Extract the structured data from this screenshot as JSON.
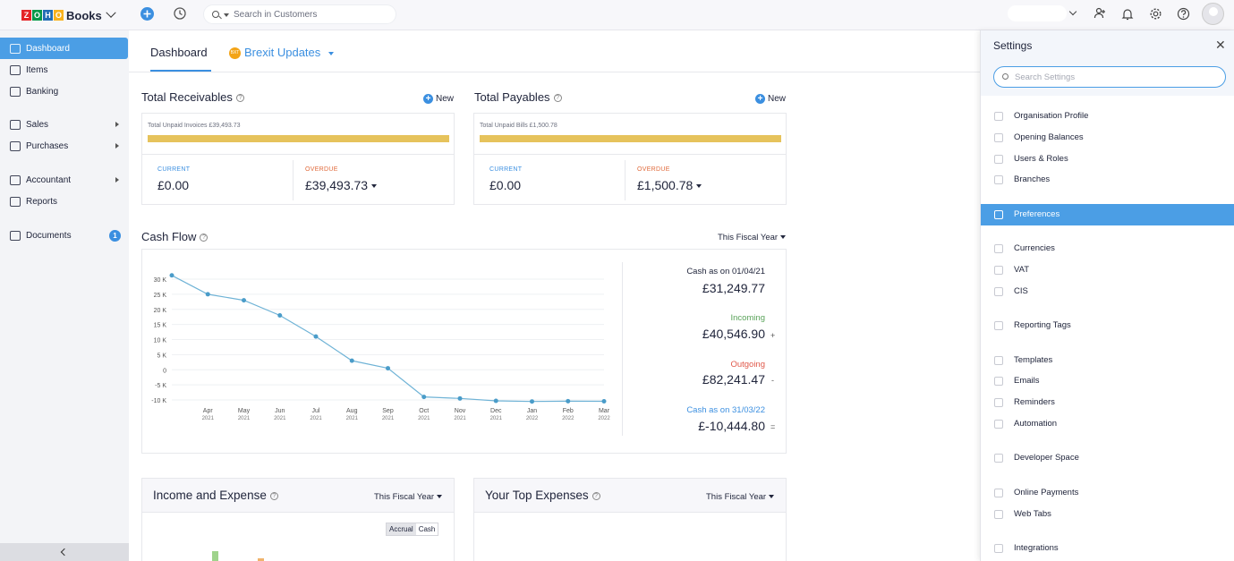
{
  "topbar": {
    "logo_letters": [
      "Z",
      "O",
      "H",
      "O"
    ],
    "logo_word": "Books",
    "search_placeholder": "Search in Customers"
  },
  "colors": {
    "accent": "#4b9ee5",
    "logo_z": "#e42527",
    "logo_o1": "#089949",
    "logo_h": "#226db4",
    "logo_o2": "#f9b21d",
    "bar": "#e6c35c",
    "current_label": "#3b8fe0",
    "overdue_label": "#e06a3b",
    "incoming": "#5aa35a",
    "outgoing": "#e0584a",
    "line": "#6fb3d6"
  },
  "sidebar": {
    "items": [
      {
        "label": "Dashboard",
        "active": true
      },
      {
        "label": "Items"
      },
      {
        "label": "Banking"
      },
      {
        "label": "Sales",
        "arrow": true
      },
      {
        "label": "Purchases",
        "arrow": true
      },
      {
        "label": "Accountant",
        "arrow": true
      },
      {
        "label": "Reports"
      },
      {
        "label": "Documents",
        "badge": "1"
      }
    ]
  },
  "tabs": {
    "dashboard": "Dashboard",
    "brexit": "Brexit Updates",
    "brexit_icon_text": "BXT"
  },
  "receivables": {
    "title": "Total Receivables",
    "new": "New",
    "unpaid": "Total Unpaid Invoices £39,493.73",
    "current_label": "CURRENT",
    "current_value": "£0.00",
    "overdue_label": "OVERDUE",
    "overdue_value": "£39,493.73",
    "paid_fraction": 1.0
  },
  "payables": {
    "title": "Total Payables",
    "new": "New",
    "unpaid": "Total Unpaid Bills £1,500.78",
    "current_label": "CURRENT",
    "current_value": "£0.00",
    "overdue_label": "OVERDUE",
    "overdue_value": "£1,500.78",
    "paid_fraction": 1.0
  },
  "cashflow": {
    "title": "Cash Flow",
    "period": "This Fiscal Year",
    "cash_start_label": "Cash as on 01/04/21",
    "cash_start": "£31,249.77",
    "incoming_label": "Incoming",
    "incoming": "£40,546.90",
    "incoming_sym": "+",
    "outgoing_label": "Outgoing",
    "outgoing": "£82,241.47",
    "outgoing_sym": "-",
    "cash_end_label": "Cash as on 31/03/22",
    "cash_end": "£-10,444.80",
    "cash_end_sym": "="
  },
  "chart_data": {
    "type": "line",
    "title": "",
    "xlabel": "",
    "ylabel": "",
    "x": [
      "Apr 2021",
      "May 2021",
      "Jun 2021",
      "Jul 2021",
      "Aug 2021",
      "Sep 2021",
      "Oct 2021",
      "Nov 2021",
      "Dec 2021",
      "Jan 2022",
      "Feb 2022",
      "Mar 2022"
    ],
    "x_months": [
      "Apr",
      "May",
      "Jun",
      "Jul",
      "Aug",
      "Sep",
      "Oct",
      "Nov",
      "Dec",
      "Jan",
      "Feb",
      "Mar"
    ],
    "x_years": [
      "2021",
      "2021",
      "2021",
      "2021",
      "2021",
      "2021",
      "2021",
      "2021",
      "2021",
      "2022",
      "2022",
      "2022"
    ],
    "series": [
      {
        "values": [
          31250,
          25000,
          23000,
          18000,
          11000,
          3000,
          500,
          -9000,
          -9500,
          -10300,
          -10500,
          -10400,
          -10445
        ]
      }
    ],
    "x_point_labels": [
      "",
      "Apr 2021",
      "May 2021",
      "Jun 2021",
      "Jul 2021",
      "Aug 2021",
      "Sep 2021",
      "Oct 2021",
      "Nov 2021",
      "Dec 2021",
      "Jan 2022",
      "Feb 2022",
      "Mar 2022"
    ],
    "yticks": [
      "30 K",
      "25 K",
      "20 K",
      "15 K",
      "10 K",
      "5 K",
      "0",
      "-5 K",
      "-10 K"
    ],
    "ylim": [
      -10000,
      30000
    ],
    "grid": true
  },
  "income_expense": {
    "title": "Income and Expense",
    "period": "This Fiscal Year",
    "accrual": "Accrual",
    "cash": "Cash"
  },
  "top_expenses": {
    "title": "Your Top Expenses",
    "period": "This Fiscal Year"
  },
  "settings": {
    "title": "Settings",
    "search_placeholder": "Search Settings",
    "items": [
      {
        "label": "Organisation Profile",
        "icon": "org-icon"
      },
      {
        "label": "Opening Balances",
        "icon": "balance-icon"
      },
      {
        "label": "Users & Roles",
        "icon": "users-icon"
      },
      {
        "label": "Branches",
        "icon": "branch-icon"
      },
      {
        "label": "Preferences",
        "icon": "sliders-icon",
        "active": true
      },
      {
        "label": "Currencies",
        "icon": "currency-icon"
      },
      {
        "label": "VAT",
        "icon": "vat-icon"
      },
      {
        "label": "CIS",
        "icon": "cis-icon"
      },
      {
        "label": "Reporting Tags",
        "icon": "tag-icon"
      },
      {
        "label": "Templates",
        "icon": "template-icon"
      },
      {
        "label": "Emails",
        "icon": "email-icon"
      },
      {
        "label": "Reminders",
        "icon": "bell-icon"
      },
      {
        "label": "Automation",
        "icon": "automation-icon"
      },
      {
        "label": "Developer Space",
        "icon": "code-icon"
      },
      {
        "label": "Online Payments",
        "icon": "payment-icon"
      },
      {
        "label": "Web Tabs",
        "icon": "webtab-icon"
      },
      {
        "label": "Integrations",
        "icon": "integration-icon"
      }
    ]
  }
}
